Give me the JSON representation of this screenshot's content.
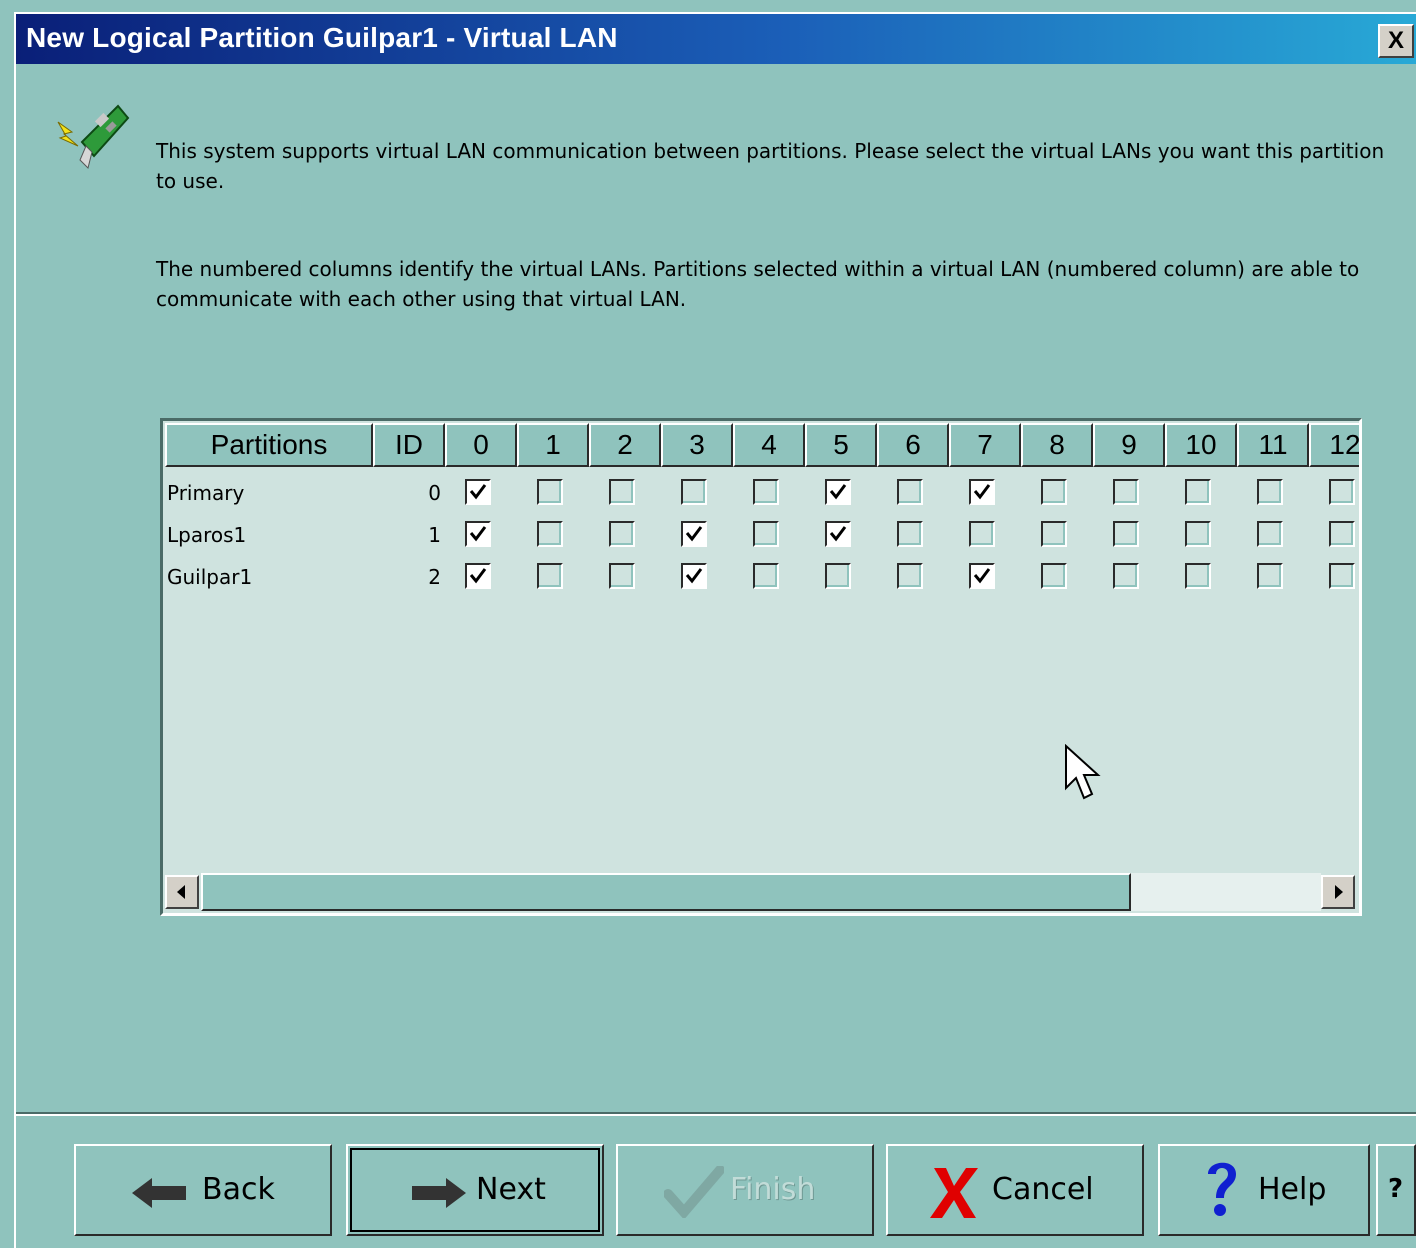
{
  "window": {
    "title": "New Logical Partition Guilpar1 - Virtual LAN",
    "close_label": "X"
  },
  "intro": {
    "paragraph1": "This system supports virtual LAN communication between partitions.  Please select the virtual LANs you want this partition to use.",
    "paragraph2": "The numbered columns identify the virtual LANs. Partitions selected within a virtual LAN (numbered column) are able to communicate with each other using that virtual LAN."
  },
  "table": {
    "headers": {
      "partitions": "Partitions",
      "id": "ID",
      "lans": [
        "0",
        "1",
        "2",
        "3",
        "4",
        "5",
        "6",
        "7",
        "8",
        "9",
        "10",
        "11",
        "12"
      ]
    },
    "rows": [
      {
        "name": "Primary",
        "id": "0",
        "checks": [
          true,
          false,
          false,
          false,
          false,
          true,
          false,
          true,
          false,
          false,
          false,
          false,
          false
        ]
      },
      {
        "name": "Lparos1",
        "id": "1",
        "checks": [
          true,
          false,
          false,
          true,
          false,
          true,
          false,
          false,
          false,
          false,
          false,
          false,
          false
        ]
      },
      {
        "name": "Guilpar1",
        "id": "2",
        "checks": [
          true,
          false,
          false,
          true,
          false,
          false,
          false,
          true,
          false,
          false,
          false,
          false,
          false
        ]
      }
    ]
  },
  "buttons": {
    "back": "Back",
    "next": "Next",
    "finish": "Finish",
    "cancel": "Cancel",
    "help": "Help",
    "context_help": "?"
  },
  "colors": {
    "background": "#8fc3bd",
    "table_background": "#cfe3df",
    "title_gradient_start": "#0a1f78",
    "title_gradient_end": "#28a9d6"
  }
}
